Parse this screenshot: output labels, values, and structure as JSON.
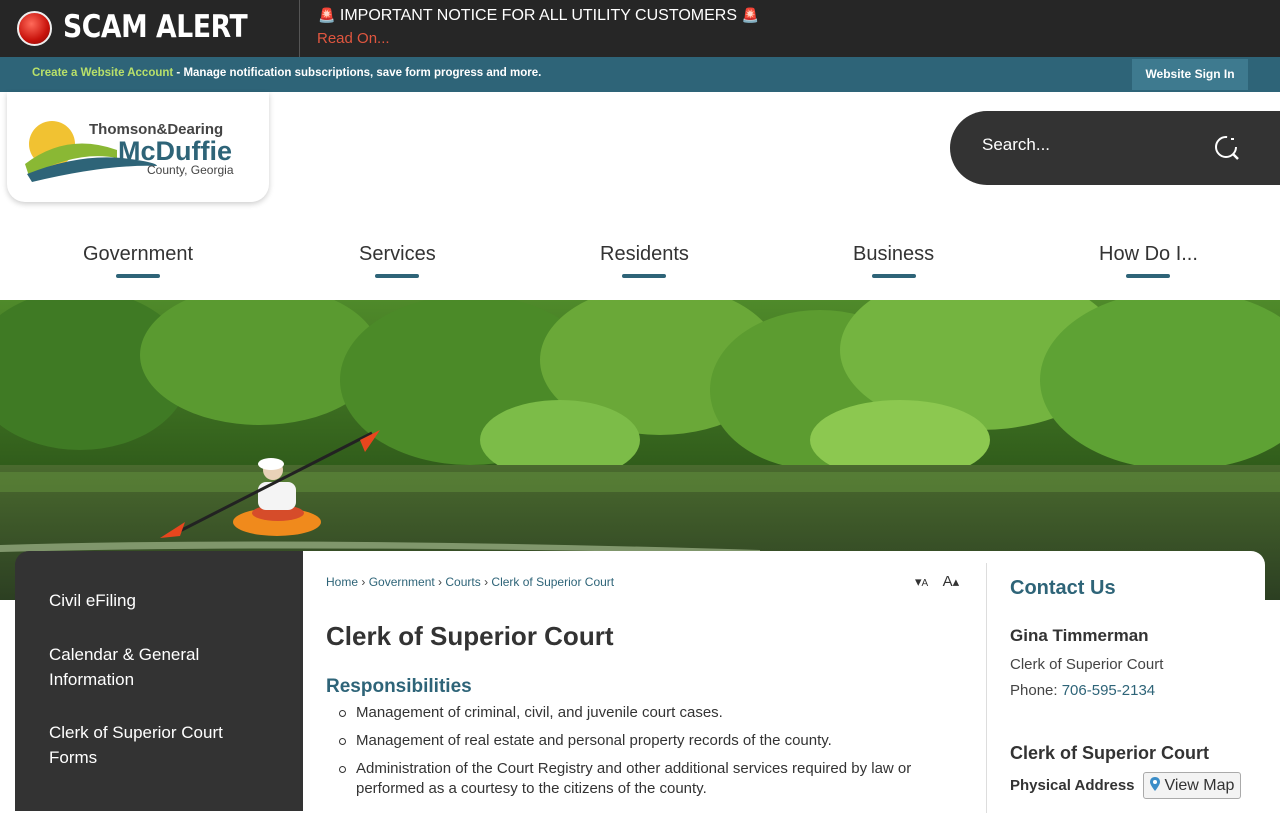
{
  "alert": {
    "title": "SCAM ALERT",
    "notice": "IMPORTANT NOTICE FOR ALL UTILITY CUSTOMERS",
    "read_on": "Read On..."
  },
  "account_bar": {
    "create_link": "Create a Website Account",
    "description": " - Manage notification subscriptions, save form progress and more.",
    "sign_in": "Website Sign In"
  },
  "logo": {
    "line1": "Thomson&Dearing",
    "line2": "McDuffie",
    "line3": "County, Georgia"
  },
  "search": {
    "placeholder": "Search..."
  },
  "nav": [
    "Government",
    "Services",
    "Residents",
    "Business",
    "How Do I..."
  ],
  "sidebar": [
    "Civil eFiling",
    "Calendar & General Information",
    "Clerk of Superior Court Forms"
  ],
  "breadcrumb": [
    "Home",
    "Government",
    "Courts",
    "Clerk of Superior Court"
  ],
  "font_controls": {
    "decrease": "A",
    "increase": "A"
  },
  "page": {
    "title": "Clerk of Superior Court",
    "section": "Responsibilities",
    "items": [
      "Management of criminal, civil, and juvenile court cases.",
      "Management of real estate and personal property records of the county.",
      "Administration of the Court Registry and other additional services required by law or performed as a courtesy to the citizens of the county."
    ]
  },
  "contact": {
    "heading": "Contact Us",
    "name": "Gina Timmerman",
    "role": "Clerk of Superior Court",
    "phone_label": "Phone: ",
    "phone": "706-595-2134",
    "office": "Clerk of Superior Court",
    "address_label": "Physical Address",
    "view_map": "View Map"
  },
  "colors": {
    "accent": "#2e6478",
    "alert_bg": "#262626",
    "read_on": "#e0563f",
    "link_green": "#b8e06a"
  }
}
